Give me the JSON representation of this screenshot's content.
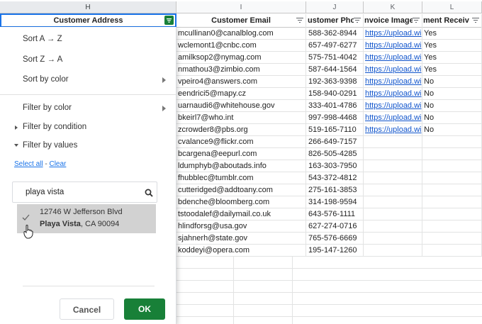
{
  "columns": [
    {
      "letter": "H"
    },
    {
      "letter": "I"
    },
    {
      "letter": "J"
    },
    {
      "letter": "K"
    },
    {
      "letter": "L"
    }
  ],
  "headers": {
    "address": "Customer Address",
    "email": "Customer Email",
    "phone": "ustomer Phor",
    "invoice": "nvoice Image",
    "payment": "ment Receiv"
  },
  "rows": [
    {
      "email": "mcullinan0@canalblog.com",
      "phone": "588-362-8944",
      "invoice": "https://upload.wi",
      "payment": "Yes"
    },
    {
      "email": "wclemont1@cnbc.com",
      "phone": "657-497-6277",
      "invoice": "https://upload.wi",
      "payment": "Yes"
    },
    {
      "email": "amilksop2@nymag.com",
      "phone": "575-751-4042",
      "invoice": "https://upload.wi",
      "payment": "Yes"
    },
    {
      "email": "nmathou3@zimbio.com",
      "phone": "587-644-1564",
      "invoice": "https://upload.wi",
      "payment": "Yes"
    },
    {
      "email": "vpeiro4@answers.com",
      "phone": "192-363-9398",
      "invoice": "https://upload.wi",
      "payment": "No"
    },
    {
      "email": "eendrici5@mapy.cz",
      "phone": "158-940-0291",
      "invoice": "https://upload.wi",
      "payment": "No"
    },
    {
      "email": "uarnaudi6@whitehouse.gov",
      "phone": "333-401-4786",
      "invoice": "https://upload.wi",
      "payment": "No"
    },
    {
      "email": "bkeirl7@who.int",
      "phone": "997-998-4468",
      "invoice": "https://upload.wi",
      "payment": "No"
    },
    {
      "email": "zcrowder8@pbs.org",
      "phone": "519-165-7110",
      "invoice": "https://upload.wi",
      "payment": "No"
    },
    {
      "email": "cvalance9@flickr.com",
      "phone": "266-649-7157",
      "invoice": "",
      "payment": ""
    },
    {
      "email": "bcargena@eepurl.com",
      "phone": "826-505-4285",
      "invoice": "",
      "payment": ""
    },
    {
      "email": "ldumphyb@aboutads.info",
      "phone": "163-303-7950",
      "invoice": "",
      "payment": ""
    },
    {
      "email": "fhubblec@tumblr.com",
      "phone": "543-372-4812",
      "invoice": "",
      "payment": ""
    },
    {
      "email": "cutteridged@addtoany.com",
      "phone": "275-161-3853",
      "invoice": "",
      "payment": ""
    },
    {
      "email": "bdenche@bloomberg.com",
      "phone": "314-198-9594",
      "invoice": "",
      "payment": ""
    },
    {
      "email": "tstoodalef@dailymail.co.uk",
      "phone": "643-576-1111",
      "invoice": "",
      "payment": ""
    },
    {
      "email": "hlindforsg@usa.gov",
      "phone": "627-274-0716",
      "invoice": "",
      "payment": ""
    },
    {
      "email": "sjahnerh@state.gov",
      "phone": "765-576-6669",
      "invoice": "",
      "payment": ""
    },
    {
      "email": "koddeyi@opera.com",
      "phone": "195-147-1260",
      "invoice": "",
      "payment": ""
    }
  ],
  "menu": {
    "sort_az": "Sort A → Z",
    "sort_za": "Sort Z → A",
    "sort_color": "Sort by color",
    "filter_color": "Filter by color",
    "filter_condition": "Filter by condition",
    "filter_values": "Filter by values",
    "select_all": "Select all",
    "separator": " - ",
    "clear": "Clear"
  },
  "search": {
    "value": "playa vista"
  },
  "result": {
    "line1": "12746 W Jefferson Blvd",
    "line2_bold": "Playa Vista",
    "line2_rest": ", CA 90094"
  },
  "buttons": {
    "cancel": "Cancel",
    "ok": "OK"
  },
  "colors": {
    "accent_green": "#188038",
    "link": "#1155cc",
    "selected_header": "#e8eaed"
  }
}
